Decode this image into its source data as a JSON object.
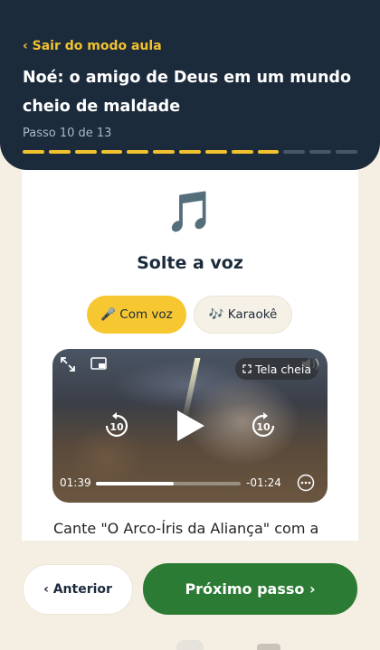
{
  "header": {
    "back_label": "‹ Sair do modo aula",
    "title": "Noé: o amigo de Deus em um mundo cheio de maldade",
    "step_label": "Passo 10 de 13",
    "steps_total": 13,
    "steps_done": 10
  },
  "section": {
    "icon": "🎵",
    "title": "Solte a voz"
  },
  "modes": {
    "with_voice": "🎤 Com voz",
    "karaoke": "🎶 Karaokê",
    "selected": "with_voice"
  },
  "video": {
    "fullscreen_label": "Tela cheia",
    "time_elapsed": "01:39",
    "time_remaining": "-01:24",
    "progress": 0.54,
    "skip_back_label": "10",
    "skip_forward_label": "10"
  },
  "body_text": "Cante \"O Arco-Íris da Aliança\" com a",
  "nav": {
    "prev_label": "‹ Anterior",
    "next_label": "Próximo passo ›"
  },
  "colors": {
    "header_bg": "#1c2b3c",
    "accent_yellow": "#f2c22e",
    "next_green": "#2c7b35",
    "page_bg": "#f5efe3"
  }
}
